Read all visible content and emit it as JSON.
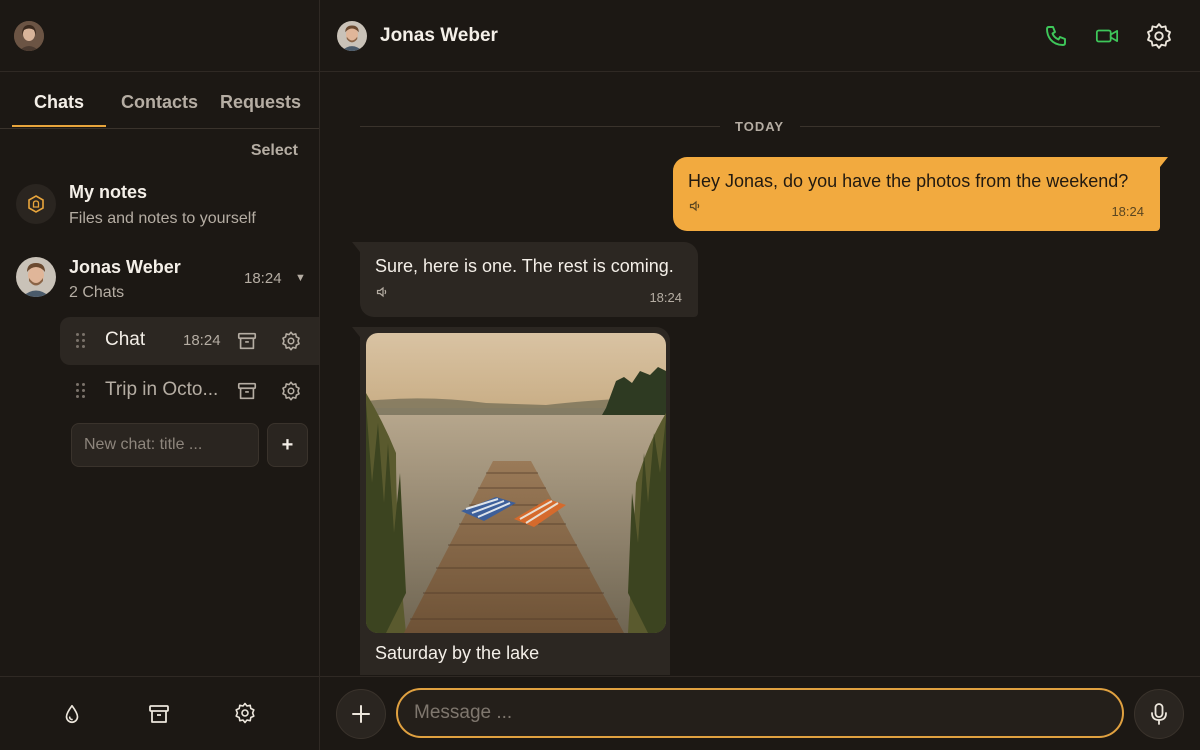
{
  "sidebar": {
    "tabs": [
      {
        "label": "Chats",
        "active": true
      },
      {
        "label": "Contacts",
        "active": false
      },
      {
        "label": "Requests",
        "active": false
      }
    ],
    "select_label": "Select",
    "notes": {
      "title": "My notes",
      "subtitle": "Files and notes to yourself",
      "icon": "notes-hex-icon"
    },
    "contact": {
      "name": "Jonas Weber",
      "subtitle": "2 Chats",
      "time": "18:24",
      "chats": [
        {
          "title": "Chat",
          "time": "18:24",
          "active": true
        },
        {
          "title": "Trip in Octo...",
          "time": "",
          "active": false
        }
      ]
    },
    "new_chat_placeholder": "New chat: title ...",
    "add_label": "+",
    "bottom_icons": [
      "drop-icon",
      "archive-icon",
      "gear-icon"
    ]
  },
  "header": {
    "name": "Jonas Weber",
    "icons": [
      "phone-icon",
      "video-icon",
      "gear-icon"
    ]
  },
  "conversation": {
    "day_label": "TODAY",
    "messages": [
      {
        "direction": "out",
        "text": "Hey Jonas, do you have the photos from the weekend?",
        "time": "18:24"
      },
      {
        "direction": "in",
        "text": "Sure, here is one. The rest is coming.",
        "time": "18:24"
      },
      {
        "direction": "in",
        "type": "image",
        "caption": "Saturday by the lake"
      }
    ]
  },
  "composer": {
    "placeholder": "Message ..."
  },
  "colors": {
    "accent": "#f2aa3f",
    "call_green": "#3ec75a",
    "background": "#1c1814",
    "bubble_in": "#2c2722"
  }
}
